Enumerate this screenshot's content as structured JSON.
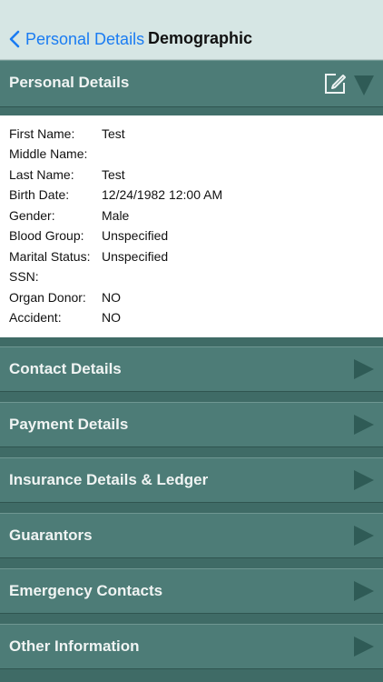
{
  "nav": {
    "back_label": "Personal Details",
    "title": "Demographic"
  },
  "personal": {
    "header": "Personal Details",
    "rows": [
      {
        "label": "First Name:",
        "value": "Test"
      },
      {
        "label": "Middle Name:",
        "value": ""
      },
      {
        "label": "Last Name:",
        "value": "Test"
      },
      {
        "label": "Birth Date:",
        "value": "12/24/1982 12:00 AM"
      },
      {
        "label": "Gender:",
        "value": "Male"
      },
      {
        "label": "Blood Group:",
        "value": "Unspecified"
      },
      {
        "label": "Marital Status:",
        "value": "Unspecified"
      },
      {
        "label": "SSN:",
        "value": ""
      },
      {
        "label": "Organ Donor:",
        "value": "NO"
      },
      {
        "label": "Accident:",
        "value": "NO"
      }
    ]
  },
  "sections": [
    {
      "label": "Contact Details"
    },
    {
      "label": "Payment Details"
    },
    {
      "label": "Insurance Details & Ledger"
    },
    {
      "label": "Guarantors"
    },
    {
      "label": "Emergency Contacts"
    },
    {
      "label": "Other Information"
    }
  ],
  "icons": {
    "back": "chevron-left-icon",
    "edit": "edit-icon",
    "expanded": "triangle-down-icon",
    "collapsed": "triangle-right-icon"
  },
  "colors": {
    "accent": "#1a7cf2",
    "header_bg": "#4d7c77",
    "navbar_bg": "#d6e6e4"
  }
}
